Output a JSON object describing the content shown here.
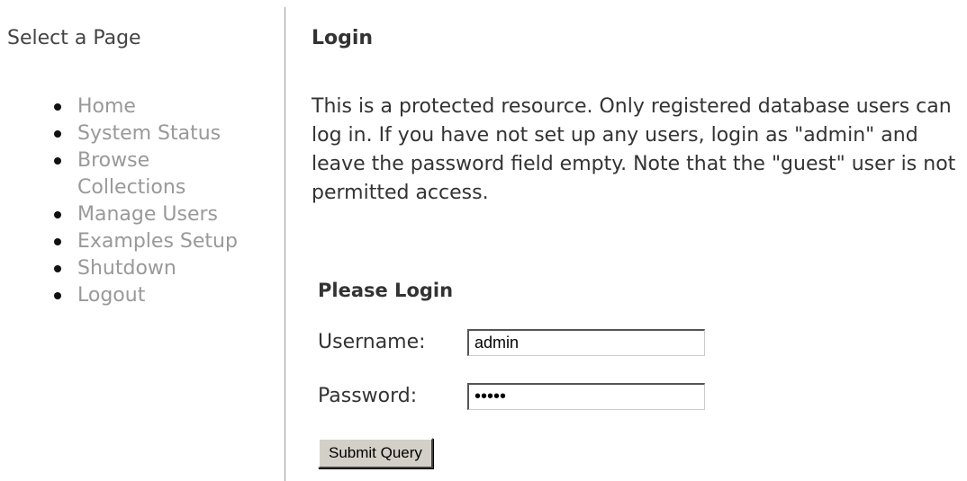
{
  "sidebar": {
    "title": "Select a Page",
    "items": [
      {
        "label": "Home"
      },
      {
        "label": "System Status"
      },
      {
        "label": "Browse Collections"
      },
      {
        "label": "Manage Users"
      },
      {
        "label": "Examples Setup"
      },
      {
        "label": "Shutdown"
      },
      {
        "label": "Logout"
      }
    ]
  },
  "main": {
    "title": "Login",
    "intro": "This is a protected resource. Only registered database users can log in. If you have not set up any users, login as \"admin\" and leave the password field empty. Note that the \"guest\" user is not permitted access.",
    "form": {
      "heading": "Please Login",
      "username_label": "Username:",
      "username_value": "admin",
      "password_label": "Password:",
      "password_value": "•••••",
      "submit_label": "Submit Query"
    }
  },
  "colors": {
    "nav_link": "#999999",
    "text": "#333333",
    "divider": "#999999",
    "button_face": "#d4d0c8"
  }
}
